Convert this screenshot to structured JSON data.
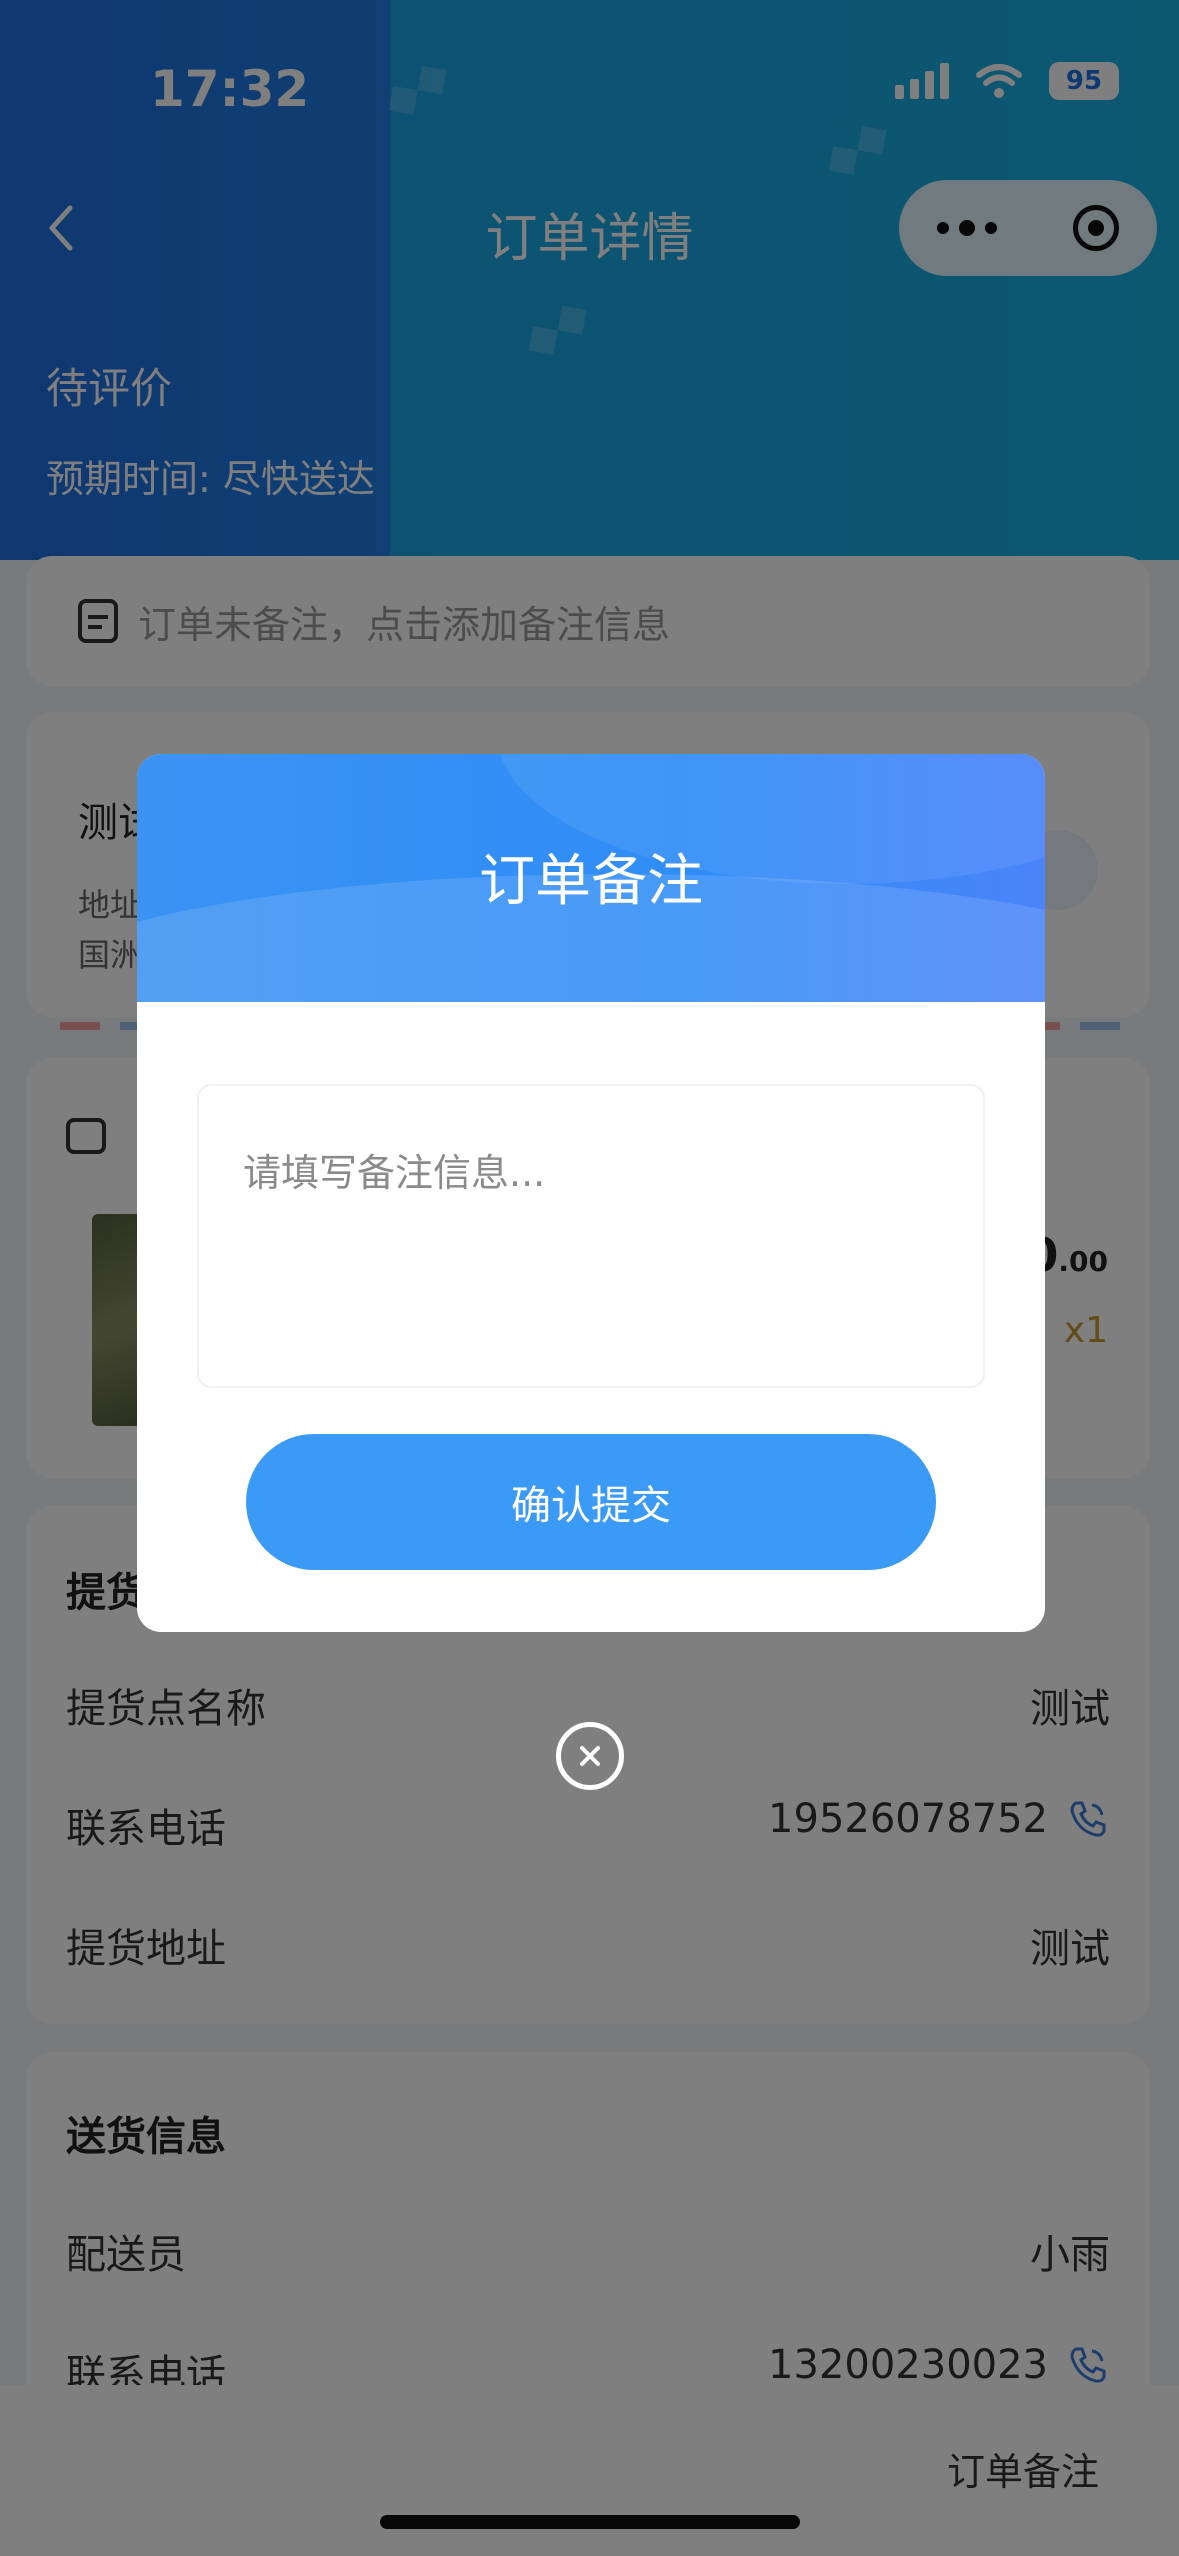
{
  "status_bar": {
    "time": "17:32",
    "battery": "95"
  },
  "nav": {
    "title": "订单详情"
  },
  "order": {
    "status": "待评价",
    "expected_time": "预期时间: 尽快送达"
  },
  "remark_card": {
    "placeholder": "订单未备注，点击添加备注信息"
  },
  "address_card": {
    "name": "测试",
    "line1": "地址",
    "line2": "国洲"
  },
  "goods": {
    "price_int": "0",
    "price_dec": ".00",
    "quantity": "x1"
  },
  "pickup": {
    "title": "提货信息",
    "rows": [
      {
        "label": "提货点名称",
        "value": "测试"
      },
      {
        "label": "联系电话",
        "value": "19526078752"
      },
      {
        "label": "提货地址",
        "value": "测试"
      }
    ]
  },
  "delivery": {
    "title": "送货信息",
    "rows": [
      {
        "label": "配送员",
        "value": "小雨"
      },
      {
        "label": "联系电话",
        "value": "13200230023"
      }
    ]
  },
  "bottom_bar": {
    "remark_link": "订单备注"
  },
  "modal": {
    "title": "订单备注",
    "input_placeholder": "请填写备注信息...",
    "submit_label": "确认提交"
  },
  "colors": {
    "primary": "#3a9af5",
    "modal_header": "#2f8df6",
    "quantity": "#c59a2c"
  }
}
